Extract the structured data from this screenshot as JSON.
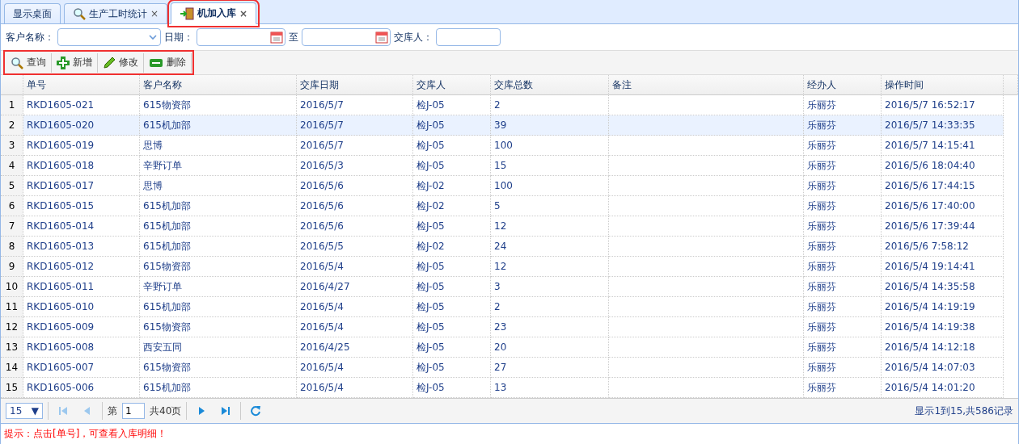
{
  "tabs": [
    {
      "label": "显示桌面",
      "closable": false,
      "selected": false,
      "highlighted": false
    },
    {
      "label": "生产工时统计",
      "closable": true,
      "selected": false,
      "highlighted": false
    },
    {
      "label": "机加入库",
      "closable": true,
      "selected": true,
      "highlighted": true
    }
  ],
  "close_glyph": "×",
  "filters": [
    {
      "kind": "select",
      "label": "客户名称："
    },
    {
      "kind": "date",
      "label": "日期："
    },
    {
      "kind": "date",
      "label": "至"
    },
    {
      "kind": "text",
      "label": "交库人："
    }
  ],
  "toolbar": {
    "highlighted": true,
    "buttons": [
      {
        "label": "查询"
      },
      {
        "label": "新增"
      },
      {
        "label": "修改"
      },
      {
        "label": "删除"
      }
    ]
  },
  "table": {
    "columns": [
      "单号",
      "客户名称",
      "交库日期",
      "交库人",
      "交库总数",
      "备注",
      "经办人",
      "操作时间"
    ],
    "rows": [
      {
        "num": "1",
        "selected": false,
        "cells": [
          "RKD1605-021",
          "615物资部",
          "2016/5/7",
          "检J-05",
          "2",
          "",
          "乐丽芬",
          "2016/5/7 16:52:17"
        ]
      },
      {
        "num": "2",
        "selected": true,
        "cells": [
          "RKD1605-020",
          "615机加部",
          "2016/5/7",
          "检J-05",
          "39",
          "",
          "乐丽芬",
          "2016/5/7 14:33:35"
        ]
      },
      {
        "num": "3",
        "selected": false,
        "cells": [
          "RKD1605-019",
          "思博",
          "2016/5/7",
          "检J-05",
          "100",
          "",
          "乐丽芬",
          "2016/5/7 14:15:41"
        ]
      },
      {
        "num": "4",
        "selected": false,
        "cells": [
          "RKD1605-018",
          "辛野订单",
          "2016/5/3",
          "检J-05",
          "15",
          "",
          "乐丽芬",
          "2016/5/6 18:04:40"
        ]
      },
      {
        "num": "5",
        "selected": false,
        "cells": [
          "RKD1605-017",
          "思博",
          "2016/5/6",
          "检J-02",
          "100",
          "",
          "乐丽芬",
          "2016/5/6 17:44:15"
        ]
      },
      {
        "num": "6",
        "selected": false,
        "cells": [
          "RKD1605-015",
          "615机加部",
          "2016/5/6",
          "检J-02",
          "5",
          "",
          "乐丽芬",
          "2016/5/6 17:40:00"
        ]
      },
      {
        "num": "7",
        "selected": false,
        "cells": [
          "RKD1605-014",
          "615机加部",
          "2016/5/6",
          "检J-05",
          "12",
          "",
          "乐丽芬",
          "2016/5/6 17:39:44"
        ]
      },
      {
        "num": "8",
        "selected": false,
        "cells": [
          "RKD1605-013",
          "615机加部",
          "2016/5/5",
          "检J-02",
          "24",
          "",
          "乐丽芬",
          "2016/5/6 7:58:12"
        ]
      },
      {
        "num": "9",
        "selected": false,
        "cells": [
          "RKD1605-012",
          "615物资部",
          "2016/5/4",
          "检J-05",
          "12",
          "",
          "乐丽芬",
          "2016/5/4 19:14:41"
        ]
      },
      {
        "num": "10",
        "selected": false,
        "cells": [
          "RKD1605-011",
          "辛野订单",
          "2016/4/27",
          "检J-05",
          "3",
          "",
          "乐丽芬",
          "2016/5/4 14:35:58"
        ]
      },
      {
        "num": "11",
        "selected": false,
        "cells": [
          "RKD1605-010",
          "615机加部",
          "2016/5/4",
          "检J-05",
          "2",
          "",
          "乐丽芬",
          "2016/5/4 14:19:19"
        ]
      },
      {
        "num": "12",
        "selected": false,
        "cells": [
          "RKD1605-009",
          "615物资部",
          "2016/5/4",
          "检J-05",
          "23",
          "",
          "乐丽芬",
          "2016/5/4 14:19:38"
        ]
      },
      {
        "num": "13",
        "selected": false,
        "cells": [
          "RKD1605-008",
          "西安五同",
          "2016/4/25",
          "检J-05",
          "20",
          "",
          "乐丽芬",
          "2016/5/4 14:12:18"
        ]
      },
      {
        "num": "14",
        "selected": false,
        "cells": [
          "RKD1605-007",
          "615物资部",
          "2016/5/4",
          "检J-05",
          "27",
          "",
          "乐丽芬",
          "2016/5/4 14:07:03"
        ]
      },
      {
        "num": "15",
        "selected": false,
        "cells": [
          "RKD1605-006",
          "615机加部",
          "2016/5/4",
          "检J-05",
          "13",
          "",
          "乐丽芬",
          "2016/5/4 14:01:20"
        ]
      }
    ]
  },
  "pager": {
    "page_size": "15",
    "dropdown_glyph": "▼",
    "page_label": "第",
    "page": "1",
    "total_label": "共40页",
    "summary": "显示1到15,共586记录"
  },
  "hint": "提示：点击[单号]，可查看入库明细！"
}
